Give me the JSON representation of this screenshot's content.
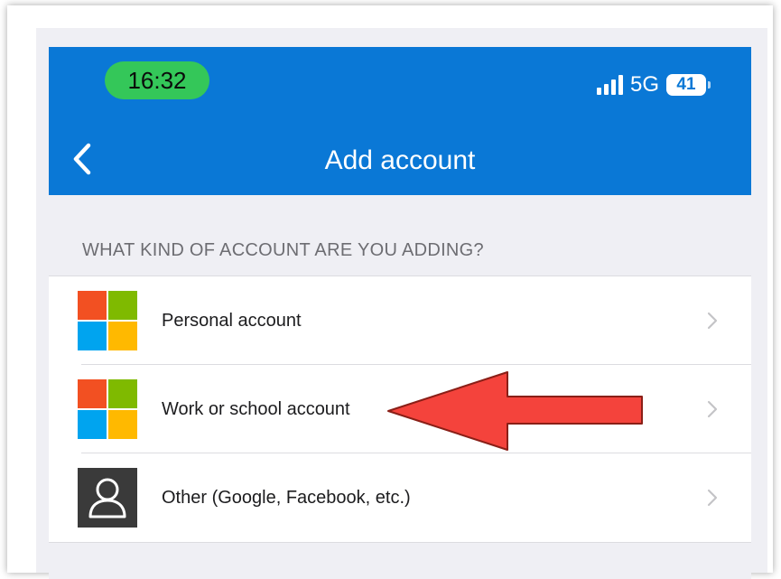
{
  "status_bar": {
    "time": "16:32",
    "network": "5G",
    "battery": "41",
    "colors": {
      "time_pill": "#34c759"
    }
  },
  "nav": {
    "title": "Add account",
    "back_icon": "chevron-left-icon",
    "background": "#0a78d6"
  },
  "section_header": "WHAT KIND OF ACCOUNT ARE YOU ADDING?",
  "account_types": [
    {
      "label": "Personal account",
      "icon": "microsoft-logo-icon"
    },
    {
      "label": "Work or school account",
      "icon": "microsoft-logo-icon"
    },
    {
      "label": "Other (Google, Facebook, etc.)",
      "icon": "person-icon"
    }
  ],
  "annotation": {
    "type": "red-arrow",
    "points_to": "Work or school account",
    "color": "#f4433c"
  }
}
